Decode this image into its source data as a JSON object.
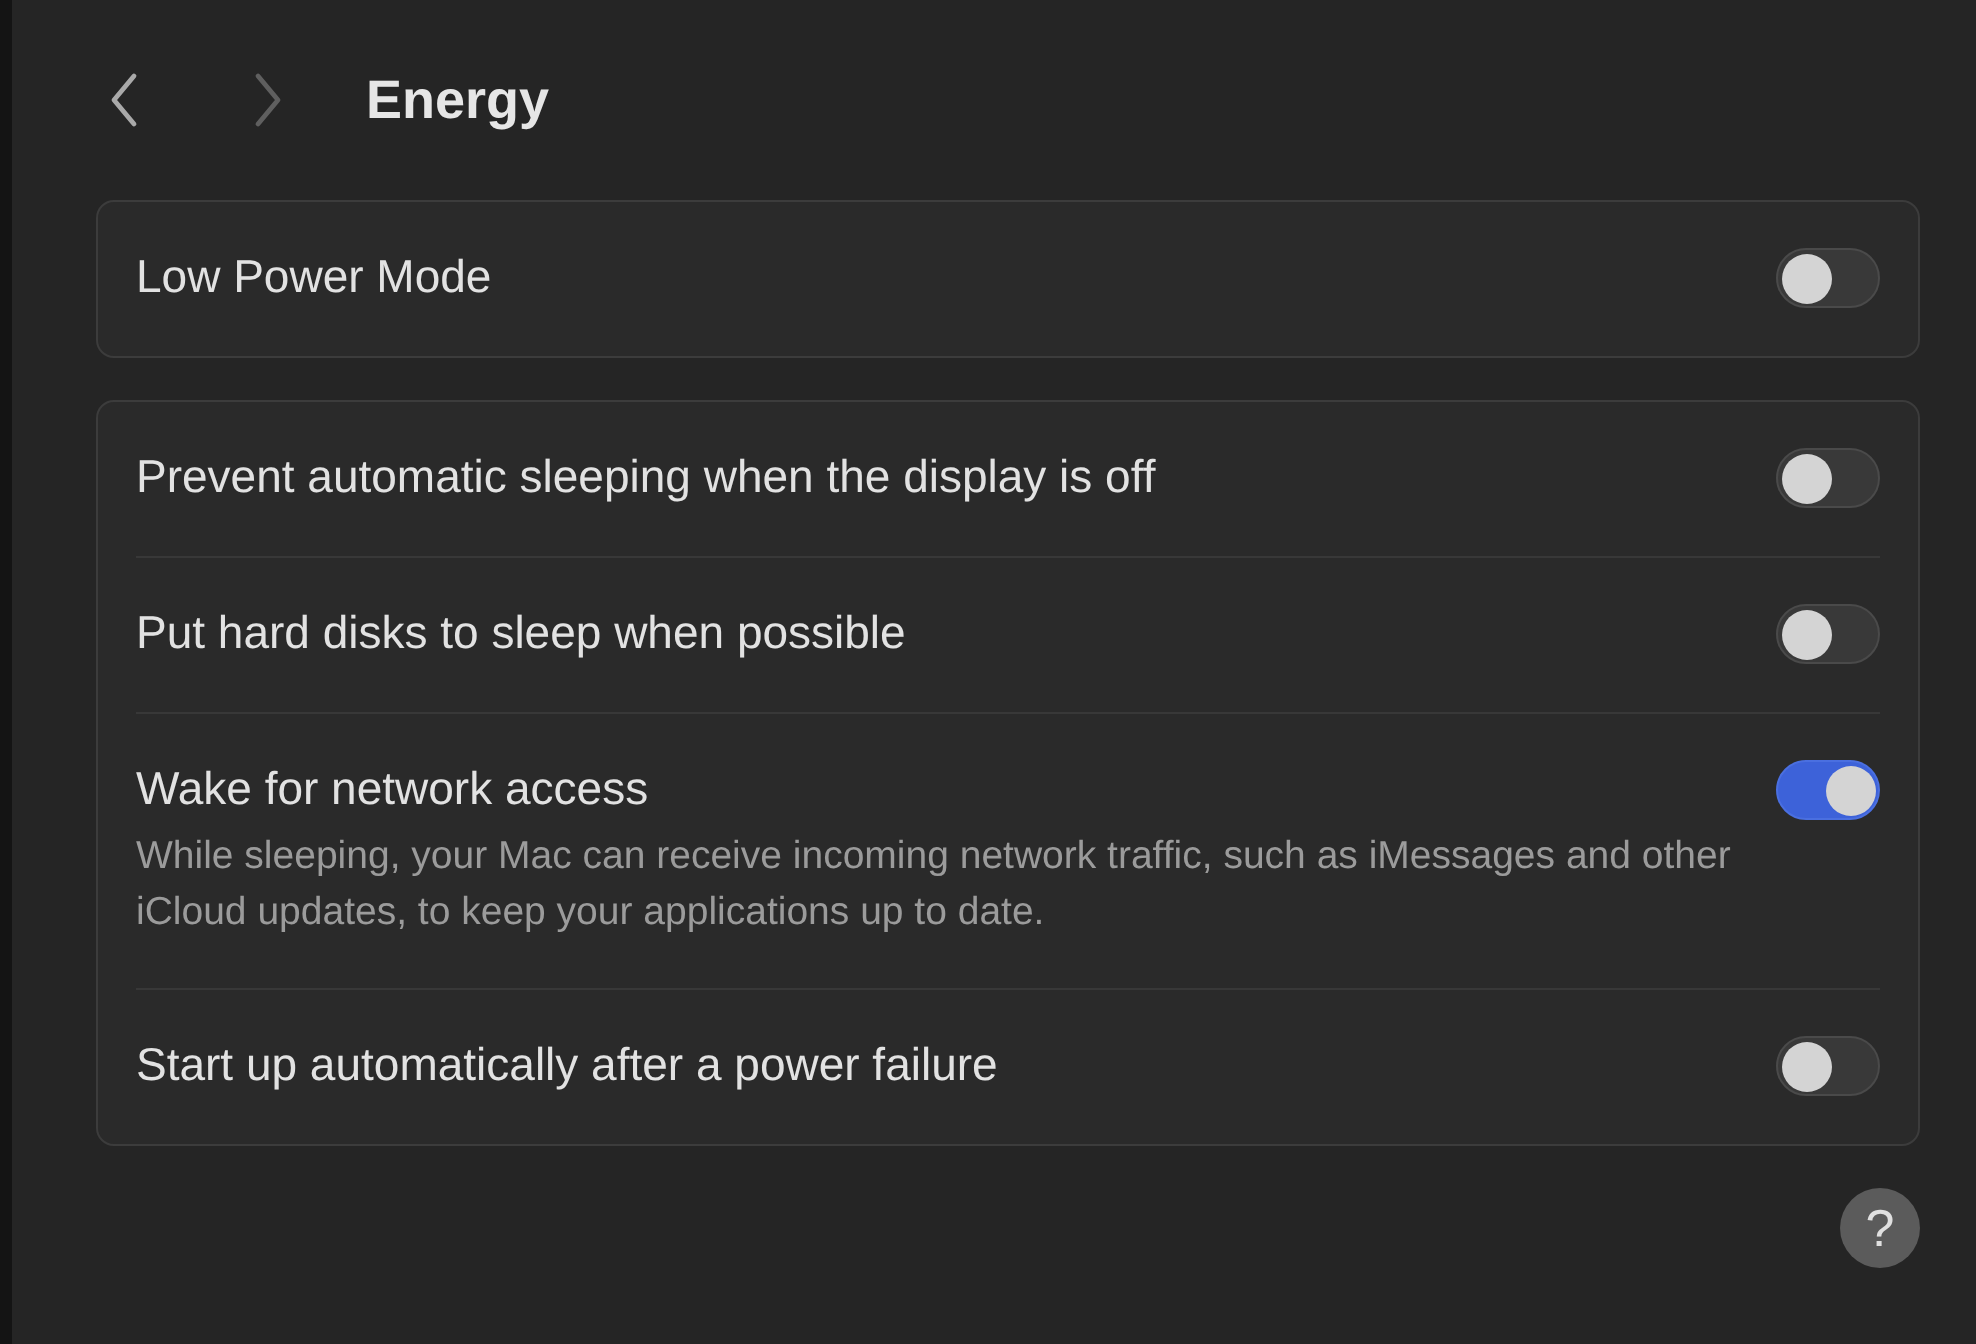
{
  "nav": {
    "back": {
      "disabled": false
    },
    "forward": {
      "disabled": true
    }
  },
  "title": "Energy",
  "groups": [
    {
      "rows": [
        {
          "label": "Low Power Mode",
          "on": false
        }
      ]
    },
    {
      "rows": [
        {
          "label": "Prevent automatic sleeping when the display is off",
          "on": false
        },
        {
          "label": "Put hard disks to sleep when possible",
          "on": false
        },
        {
          "label": "Wake for network access",
          "on": true,
          "description": "While sleeping, your Mac can receive incoming network traffic, such as iMessages and other iCloud updates, to keep your applications up to date."
        },
        {
          "label": "Start up automatically after a power failure",
          "on": false
        }
      ]
    }
  ],
  "help": "?"
}
